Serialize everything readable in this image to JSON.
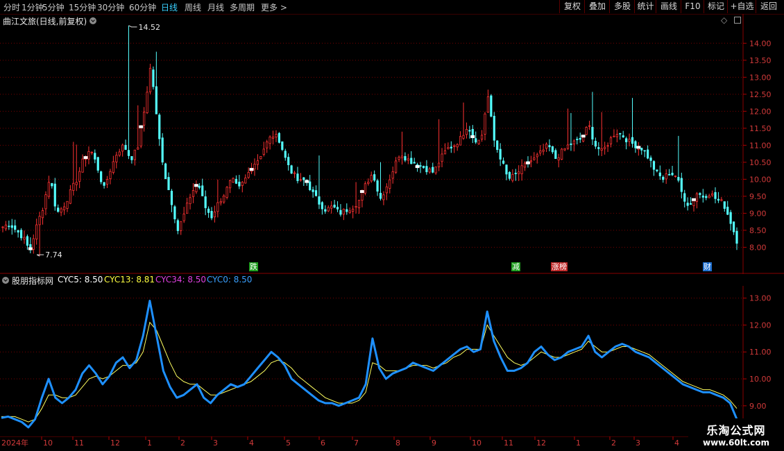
{
  "toolbar": {
    "periods": [
      "分时",
      "1分钟",
      "5分钟",
      "15分钟",
      "30分钟",
      "60分钟",
      "日线",
      "周线",
      "月线",
      "多周期",
      "更多 >"
    ],
    "active_period": "日线",
    "buttons": [
      "复权",
      "叠加",
      "多股",
      "统计",
      "画线",
      "F10",
      "标记",
      "+自选",
      "返回"
    ]
  },
  "main_panel": {
    "title": "曲江文旅(日线,前复权)",
    "max_label": "14.52",
    "min_label": "7.74",
    "events": [
      {
        "text": "跌",
        "color": "#1e9e1e"
      },
      {
        "text": "减",
        "color": "#1e9e1e"
      },
      {
        "text": "涨榜",
        "color": "#c02828"
      },
      {
        "text": "财",
        "color": "#1e6fd0"
      }
    ]
  },
  "indicator": {
    "name": "股朋指标网",
    "legend": [
      {
        "label": "CYC5: 8.50",
        "color": "#ffffff"
      },
      {
        "label": "CYC13: 8.81",
        "color": "#ffff40"
      },
      {
        "label": "CYC34: 8.50",
        "color": "#e040e0"
      },
      {
        "label": "CYC0: 8.50",
        "color": "#3aa0ff"
      }
    ]
  },
  "dates": {
    "year_label": "2024年",
    "months": [
      "10",
      "11",
      "12",
      "1",
      "2",
      "3",
      "4",
      "5",
      "6",
      "7",
      "8",
      "9",
      "10",
      "11",
      "12",
      "1",
      "2",
      "3",
      "4"
    ]
  },
  "watermark": {
    "line1": "乐淘公式网",
    "line2": "www.60lt.com"
  },
  "colors": {
    "up": "#ff3232",
    "down": "#54ffff",
    "grid": "#7a0000",
    "cyc0": "#1e90ff",
    "cyc13": "#ffff60"
  },
  "chart_data": [
    {
      "type": "candlestick",
      "title": "曲江文旅(日线,前复权)",
      "y_axis_ticks": [
        "14.00",
        "13.50",
        "13.00",
        "12.50",
        "12.00",
        "11.50",
        "11.00",
        "10.50",
        "10.00",
        "9.50",
        "9.00",
        "8.50",
        "8.00"
      ],
      "ylim": [
        7.6,
        14.7
      ],
      "high": 14.52,
      "low": 7.74,
      "close_path": [
        8.6,
        8.7,
        8.5,
        8.3,
        7.9,
        8.6,
        9.2,
        10.1,
        9.0,
        9.2,
        9.6,
        10.0,
        10.6,
        10.9,
        10.4,
        9.7,
        10.3,
        10.8,
        11.0,
        10.6,
        10.9,
        12.0,
        13.4,
        11.5,
        10.2,
        9.4,
        8.5,
        9.0,
        9.6,
        9.9,
        9.2,
        8.9,
        9.3,
        9.6,
        10.0,
        9.7,
        10.0,
        10.4,
        10.6,
        11.0,
        11.3,
        11.2,
        10.6,
        10.2,
        9.9,
        10.0,
        9.6,
        9.3,
        9.1,
        9.2,
        9.0,
        9.1,
        9.2,
        9.4,
        9.9,
        10.2,
        9.4,
        9.8,
        10.3,
        10.8,
        10.6,
        10.5,
        10.4,
        10.3,
        10.2,
        10.6,
        10.9,
        11.0,
        11.2,
        11.6,
        11.2,
        11.1,
        12.5,
        11.1,
        10.6,
        10.0,
        10.1,
        10.3,
        10.5,
        10.6,
        10.8,
        11.0,
        10.6,
        10.8,
        11.0,
        11.1,
        11.2,
        11.6,
        11.0,
        10.8,
        11.1,
        11.4,
        11.3,
        11.1,
        11.0,
        10.9,
        10.6,
        10.2,
        10.0,
        10.2,
        10.1,
        9.5,
        9.2,
        9.6,
        9.5,
        9.6,
        9.4,
        9.3,
        8.8,
        8.2
      ]
    },
    {
      "type": "line",
      "name": "股朋指标网",
      "y_axis_ticks": [
        "13.00",
        "12.00",
        "11.00",
        "10.00",
        "9.00"
      ],
      "ylim": [
        8.3,
        13.3
      ],
      "series": [
        {
          "name": "CYC0",
          "values": [
            8.55,
            8.6,
            8.5,
            8.4,
            8.2,
            8.5,
            9.3,
            10.0,
            9.3,
            9.1,
            9.3,
            9.6,
            10.2,
            10.5,
            10.2,
            9.8,
            10.1,
            10.6,
            10.8,
            10.4,
            10.7,
            11.6,
            12.9,
            11.6,
            10.3,
            9.7,
            9.3,
            9.4,
            9.6,
            9.8,
            9.3,
            9.1,
            9.4,
            9.6,
            9.8,
            9.7,
            9.8,
            10.1,
            10.4,
            10.7,
            11.0,
            10.8,
            10.5,
            10.0,
            9.8,
            9.6,
            9.4,
            9.2,
            9.1,
            9.1,
            9.0,
            9.1,
            9.2,
            9.3,
            9.8,
            11.5,
            10.4,
            10.0,
            10.2,
            10.3,
            10.4,
            10.6,
            10.5,
            10.4,
            10.3,
            10.5,
            10.7,
            10.9,
            11.1,
            11.2,
            11.0,
            11.1,
            12.5,
            11.4,
            10.8,
            10.3,
            10.3,
            10.4,
            10.6,
            11.0,
            11.2,
            10.9,
            10.7,
            10.8,
            11.0,
            11.1,
            11.2,
            11.6,
            11.0,
            10.8,
            11.0,
            11.2,
            11.3,
            11.2,
            11.0,
            10.9,
            10.8,
            10.6,
            10.4,
            10.2,
            10.0,
            9.8,
            9.7,
            9.6,
            9.5,
            9.5,
            9.4,
            9.3,
            9.1,
            8.5
          ]
        },
        {
          "name": "CYC13",
          "values": [
            8.6,
            8.6,
            8.6,
            8.5,
            8.4,
            8.5,
            8.9,
            9.4,
            9.4,
            9.3,
            9.3,
            9.4,
            9.7,
            10.0,
            10.1,
            10.0,
            10.1,
            10.3,
            10.5,
            10.5,
            10.6,
            11.0,
            12.1,
            11.8,
            11.2,
            10.6,
            10.1,
            9.9,
            9.8,
            9.8,
            9.6,
            9.4,
            9.4,
            9.5,
            9.6,
            9.7,
            9.8,
            9.9,
            10.1,
            10.3,
            10.6,
            10.7,
            10.6,
            10.4,
            10.1,
            9.9,
            9.7,
            9.5,
            9.3,
            9.2,
            9.1,
            9.1,
            9.1,
            9.2,
            9.5,
            10.6,
            10.5,
            10.3,
            10.3,
            10.3,
            10.4,
            10.5,
            10.5,
            10.5,
            10.4,
            10.5,
            10.6,
            10.8,
            10.9,
            11.1,
            11.1,
            11.1,
            12.0,
            11.6,
            11.2,
            10.8,
            10.6,
            10.5,
            10.6,
            10.8,
            11.0,
            10.9,
            10.8,
            10.8,
            10.9,
            11.0,
            11.1,
            11.4,
            11.2,
            11.0,
            11.0,
            11.1,
            11.2,
            11.2,
            11.1,
            11.0,
            10.9,
            10.7,
            10.5,
            10.3,
            10.1,
            9.9,
            9.8,
            9.7,
            9.6,
            9.6,
            9.5,
            9.4,
            9.2,
            8.9
          ]
        }
      ]
    }
  ]
}
